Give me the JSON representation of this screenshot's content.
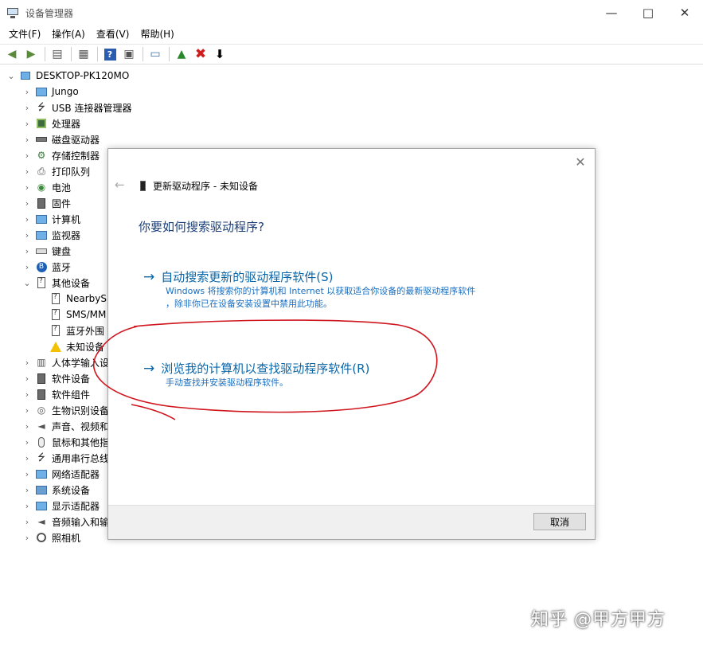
{
  "window": {
    "title": "设备管理器",
    "minimize_icon": "minimize-icon",
    "maximize_icon": "maximize-icon",
    "close_icon": "close-icon"
  },
  "menu": [
    "文件(F)",
    "操作(A)",
    "查看(V)",
    "帮助(H)"
  ],
  "tree": {
    "root": "DESKTOP-PK120MO",
    "items": [
      {
        "label": "Jungo",
        "icon": "monitor-icon"
      },
      {
        "label": "USB 连接器管理器",
        "icon": "usb-icon"
      },
      {
        "label": "处理器",
        "icon": "processor-icon"
      },
      {
        "label": "磁盘驱动器",
        "icon": "disk-icon"
      },
      {
        "label": "存储控制器",
        "icon": "storage-icon"
      },
      {
        "label": "打印队列",
        "icon": "printer-icon"
      },
      {
        "label": "电池",
        "icon": "battery-icon"
      },
      {
        "label": "固件",
        "icon": "firmware-icon"
      },
      {
        "label": "计算机",
        "icon": "computer-icon"
      },
      {
        "label": "监视器",
        "icon": "monitor-icon"
      },
      {
        "label": "键盘",
        "icon": "keyboard-icon"
      },
      {
        "label": "蓝牙",
        "icon": "bluetooth-icon"
      },
      {
        "label": "其他设备",
        "icon": "other-devices-icon"
      }
    ],
    "sub_items": [
      {
        "label": "NearbyS",
        "icon": "unknown-device-icon"
      },
      {
        "label": "SMS/MM",
        "icon": "unknown-device-icon"
      },
      {
        "label": "蓝牙外围",
        "icon": "unknown-device-icon"
      },
      {
        "label": "未知设备",
        "icon": "warning-device-icon"
      }
    ],
    "items_after": [
      {
        "label": "人体学输入设",
        "icon": "hid-icon"
      },
      {
        "label": "软件设备",
        "icon": "software-device-icon"
      },
      {
        "label": "软件组件",
        "icon": "software-component-icon"
      },
      {
        "label": "生物识别设备",
        "icon": "biometric-icon"
      },
      {
        "label": "声音、视频和",
        "icon": "sound-icon"
      },
      {
        "label": "鼠标和其他指",
        "icon": "mouse-icon"
      },
      {
        "label": "通用串行总线",
        "icon": "usb-icon"
      },
      {
        "label": "网络适配器",
        "icon": "network-icon"
      },
      {
        "label": "系统设备",
        "icon": "system-icon"
      },
      {
        "label": "显示适配器",
        "icon": "display-icon"
      },
      {
        "label": "音频输入和输",
        "icon": "audio-icon"
      },
      {
        "label": "照相机",
        "icon": "camera-icon"
      }
    ]
  },
  "dialog": {
    "header": "更新驱动程序 - 未知设备",
    "question": "你要如何搜索驱动程序?",
    "option_auto": {
      "title": "自动搜索更新的驱动程序软件(S)",
      "desc_line1": "Windows 将搜索你的计算机和 Internet 以获取适合你设备的最新驱动程序软件",
      "desc_line2": "，除非你已在设备安装设置中禁用此功能。"
    },
    "option_browse": {
      "title": "浏览我的计算机以查找驱动程序软件(R)",
      "desc": "手动查找并安装驱动程序软件。"
    },
    "cancel": "取消"
  },
  "watermark": "知乎 @甲方甲方",
  "colors": {
    "link": "#0b66a8",
    "heading": "#1a3e78",
    "annotation": "#d0151e"
  }
}
